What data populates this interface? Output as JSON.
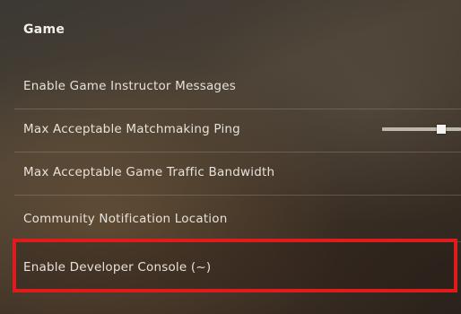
{
  "section": {
    "title": "Game"
  },
  "settings": [
    {
      "label": "Enable Game Instructor Messages"
    },
    {
      "label": "Max Acceptable Matchmaking Ping",
      "slider_value": 0.75
    },
    {
      "label": "Max Acceptable Game Traffic Bandwidth"
    },
    {
      "label": "Community Notification Location"
    },
    {
      "label": "Enable Developer Console (~)"
    }
  ],
  "colors": {
    "highlight": "#e01b1b",
    "text": "#e6e2da",
    "divider": "rgba(220,210,195,0.22)"
  }
}
